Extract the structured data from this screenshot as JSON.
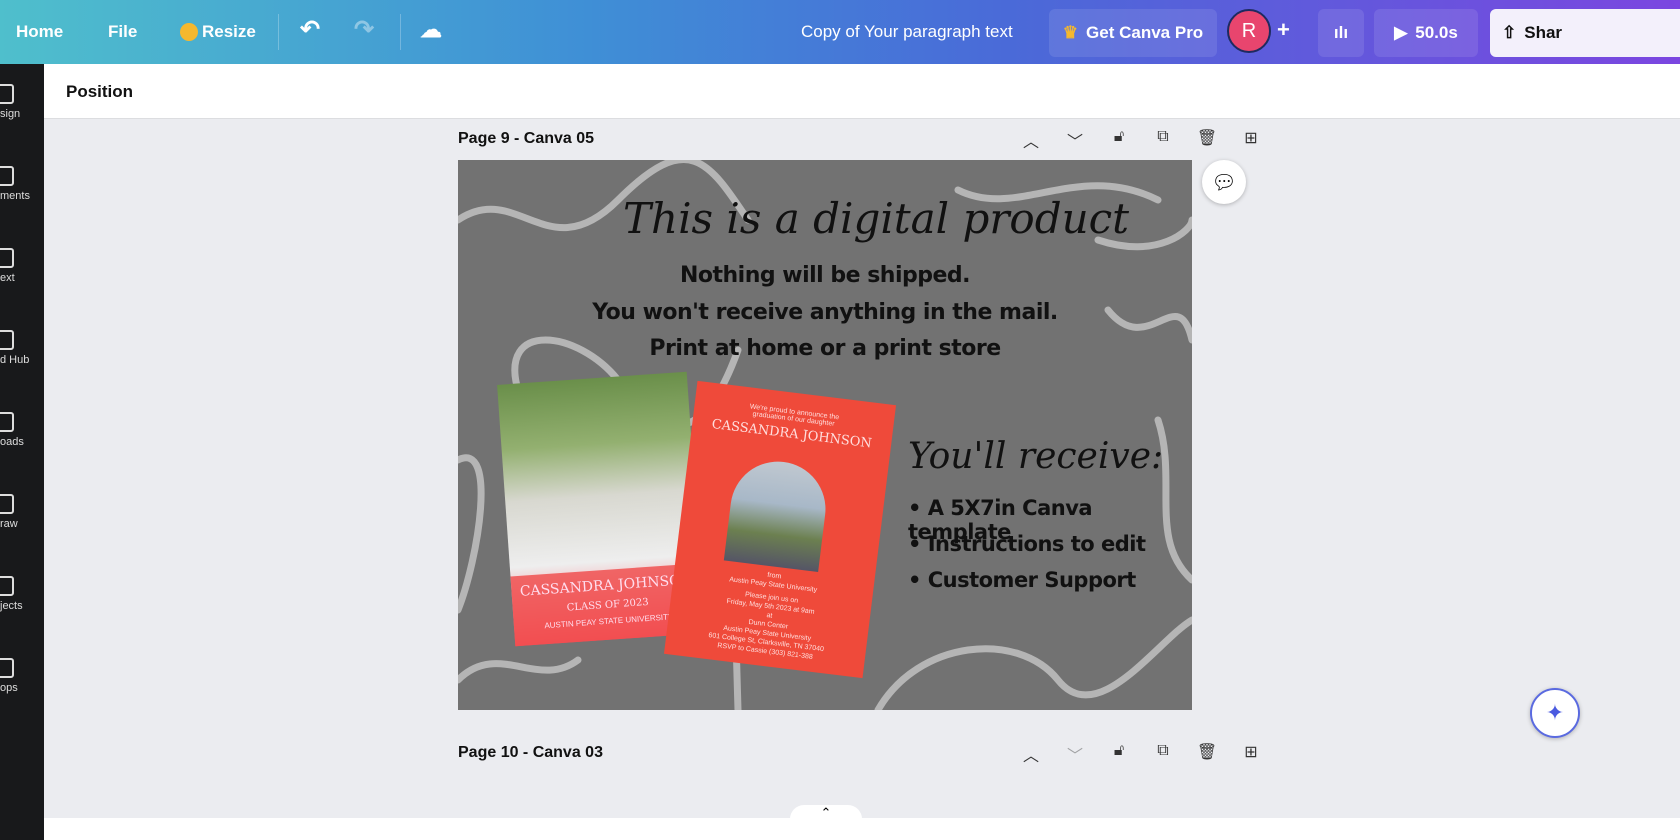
{
  "topbar": {
    "home": "Home",
    "file": "File",
    "resize": "Resize",
    "doc_title": "Copy of Your paragraph text",
    "get_pro": "Get Canva Pro",
    "avatar": "R",
    "play_time": "50.0s",
    "share": "Shar"
  },
  "sidebar": [
    {
      "label": "sign"
    },
    {
      "label": "ments"
    },
    {
      "label": "ext"
    },
    {
      "label": "d Hub"
    },
    {
      "label": "oads"
    },
    {
      "label": "raw"
    },
    {
      "label": "jects"
    },
    {
      "label": "ops"
    }
  ],
  "toolbar": {
    "position": "Position"
  },
  "pages": [
    {
      "label": "Page 9 - Canva 05"
    },
    {
      "label": "Page 10 - Canva 03"
    }
  ],
  "design": {
    "heading": "This is a digital product",
    "lines": [
      "Nothing will be shipped.",
      "You won't receive anything in the mail.",
      "Print at home or a print store"
    ],
    "receive": "You'll receive:",
    "bullets": [
      "A 5X7in Canva template",
      "Instructions to edit",
      "Customer Support"
    ],
    "card1": {
      "name": "CASSANDRA JOHNSON",
      "class": "CLASS OF 2023",
      "school": "AUSTIN PEAY STATE UNIVERSITY"
    },
    "card2": {
      "intro": "We're proud to announce the graduation of our daughter",
      "name": "CASSANDRA JOHNSON",
      "from": "from",
      "school": "Austin Peay State University",
      "join": "Please join us on",
      "date": "Friday, May 5th 2023 at 9am",
      "at": "at",
      "venue": "Dunn Center",
      "venue_school": "Austin Peay State University",
      "address": "601 College St, Clarksville, TN 37040",
      "rsvp": "RSVP to Cassie (303) 821-388"
    }
  }
}
